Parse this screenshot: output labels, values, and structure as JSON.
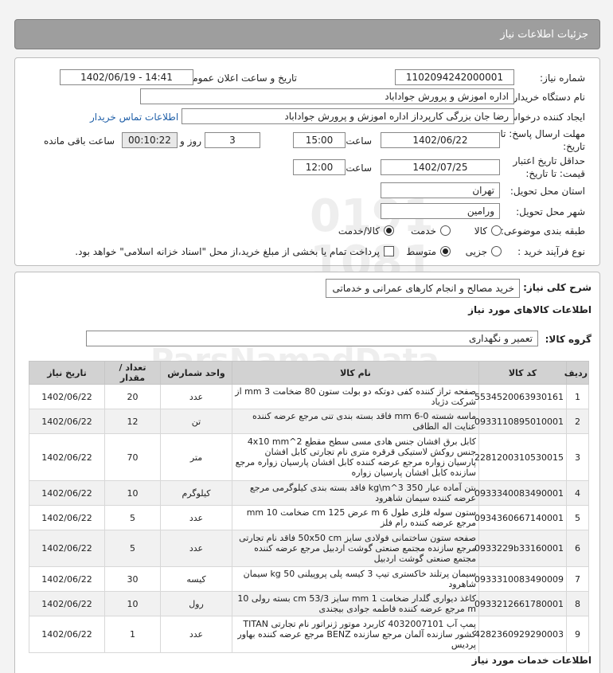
{
  "page": {
    "title": "جزئیات اطلاعات نیاز"
  },
  "form": {
    "need_number_label": "شماره نیاز:",
    "need_number": "1102094242000001",
    "announce_label": "تاریخ و ساعت اعلان عمومی:",
    "announce_value": "1402/06/19 - 14:41",
    "buyer_label": "نام دستگاه خریدار:",
    "buyer_value": "اداره اموزش و پرورش جواداباد",
    "creator_label": "ایجاد کننده درخواست:",
    "creator_value": "رضا جان بزرگی کارپرداز اداره اموزش و پرورش جواداباد",
    "contact_link": "اطلاعات تماس خریدار",
    "deadline_label_1": "مهلت ارسال پاسخ: تا",
    "deadline_label_2": "تاریخ:",
    "deadline_date": "1402/06/22",
    "time_label": "ساعت",
    "deadline_time": "15:00",
    "days_value": "3",
    "days_label": "روز و",
    "remaining_value": "00:10:22",
    "remaining_label": "ساعت باقی مانده",
    "validity_label_1": "حداقل تاریخ اعتبار",
    "validity_label_2": "قیمت: تا تاریخ:",
    "validity_date": "1402/07/25",
    "validity_time_label": "ساعت",
    "validity_time": "12:00",
    "province_label": "استان محل تحویل:",
    "province_value": "تهران",
    "city_label": "شهر محل تحویل:",
    "city_value": "ورامین",
    "category_label": "طبقه بندی موضوعی:",
    "category_options": [
      "کالا",
      "خدمت",
      "کالا/خدمت"
    ],
    "category_selected": 2,
    "process_label": "نوع فرآیند خرید :",
    "process_options": [
      "جزیی",
      "متوسط"
    ],
    "process_selected": 1,
    "payment_note": "پرداخت تمام یا بخشی از مبلغ خرید،از محل \"اسناد خزانه اسلامی\" خواهد بود."
  },
  "summary": {
    "label": "شرح کلی نیاز:",
    "value": "خرید مصالح و انجام کارهای عمرانی و خدماتی"
  },
  "goods": {
    "section_title": "اطلاعات کالاهای مورد نیاز",
    "group_label": "گروه کالا:",
    "group_value": "تعمیر و نگهداری",
    "columns": {
      "row": "ردیف",
      "code": "کد کالا",
      "name": "نام کالا",
      "unit": "واحد شمارش",
      "qty": "تعداد / مقدار",
      "date": "تاریخ نیاز"
    },
    "rows": [
      {
        "row": "1",
        "code": "5534520063930161",
        "name": "صفحه تراز کننده کفی دوتکه دو بولت ستون 80 ضخامت 3 mm از شرکت دژیاد",
        "unit": "عدد",
        "qty": "20",
        "date": "1402/06/22"
      },
      {
        "row": "2",
        "code": "0933110895010001",
        "name": "ماسه شسته 0-6 mm فاقد بسته بندی تنی مرجع عرضه کننده عنایت اله الطافی",
        "unit": "تن",
        "qty": "12",
        "date": "1402/06/22"
      },
      {
        "row": "3",
        "code": "2281200310530015",
        "name": "کابل برق افشان جنس هادی مسی سطح مقطع 4x10 mm^2 جنس روکش لاستیکی قرقره متری نام تجارتی کابل افشان پارسیان زواره مرجع عرضه کننده کابل افشان پارسیان زواره مرجع سازنده کابل افشان پارسیان زواره",
        "unit": "متر",
        "qty": "70",
        "date": "1402/06/22"
      },
      {
        "row": "4",
        "code": "0933340083490001",
        "name": "بتن آماده عیار 350 kg\\m^3 فاقد بسته بندی کیلوگرمی مرجع عرضه کننده سیمان شاهرود",
        "unit": "کیلوگرم",
        "qty": "10",
        "date": "1402/06/22"
      },
      {
        "row": "5",
        "code": "0934360667140001",
        "name": "ستون سوله فلزی طول 6 m عرض 125 cm ضخامت 10 mm مرجع عرضه کننده رام فلز",
        "unit": "عدد",
        "qty": "5",
        "date": "1402/06/22"
      },
      {
        "row": "6",
        "code": "0933229b33160001",
        "name": "صفحه ستون ساختمانی فولادی سایز 50x50 cm فاقد نام تجارتی مرجع سازنده مجتمع صنعتی گوشت اردبیل مرجع عرضه کننده مجتمع صنعتی گوشت اردبیل",
        "unit": "عدد",
        "qty": "5",
        "date": "1402/06/22"
      },
      {
        "row": "7",
        "code": "0933310083490009",
        "name": "سیمان پرتلند خاکستری تیپ 3 کیسه پلی پروپیلنی 50 kg سیمان شاهرود",
        "unit": "کیسه",
        "qty": "30",
        "date": "1402/06/22"
      },
      {
        "row": "8",
        "code": "0933212661780001",
        "name": "کاغذ دیواری گلدار ضخامت 1 mm سایز 53/3 cm بسته رولی 10 m مرجع عرضه کننده فاطمه جوادی بیجندی",
        "unit": "رول",
        "qty": "10",
        "date": "1402/06/22"
      },
      {
        "row": "9",
        "code": "4282360929290003",
        "name": "پمپ آب 4032007101 کاربرد موتور ژنراتور نام تجارتی TITAN کشور سازنده آلمان مرجع سازنده BENZ مرجع عرضه کننده بهاور پردیس",
        "unit": "عدد",
        "qty": "1",
        "date": "1402/06/22"
      }
    ]
  },
  "services": {
    "section_title": "اطلاعات خدمات مورد نیاز"
  },
  "watermark": {
    "line1": "ParsNamadData",
    "line2": "پایگاه اطلاع رسانی مناقصه و مزایده",
    "line3": "۰۲۱-۸۸۳۴۹۶۷۰",
    "digits": "0191 1081"
  },
  "colors": {
    "header": "#9e9e9e",
    "link": "#1f5fa8",
    "table_header": "#d2d2d2"
  }
}
